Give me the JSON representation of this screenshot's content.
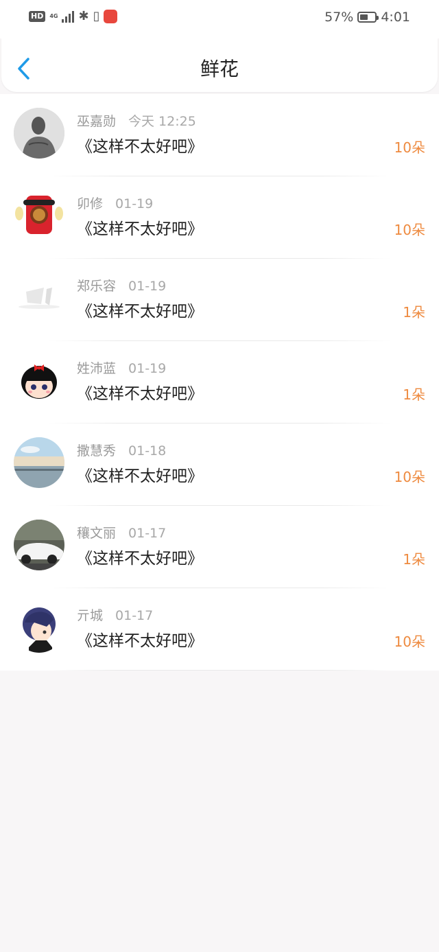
{
  "status_bar": {
    "hd": "HD",
    "network": "4G",
    "battery_percent": "57%",
    "battery_level": 0.57,
    "time": "4:01"
  },
  "header": {
    "title": "鲜花"
  },
  "list": [
    {
      "name": "巫嘉勋",
      "time": "今天 12:25",
      "message": "《这样不太好吧》",
      "count": "10朵"
    },
    {
      "name": "卯修",
      "time": "01-19",
      "message": "《这样不太好吧》",
      "count": "10朵"
    },
    {
      "name": "郑乐容",
      "time": "01-19",
      "message": "《这样不太好吧》",
      "count": "1朵"
    },
    {
      "name": "姓沛蓝",
      "time": "01-19",
      "message": "《这样不太好吧》",
      "count": "1朵"
    },
    {
      "name": "撒慧秀",
      "time": "01-18",
      "message": "《这样不太好吧》",
      "count": "10朵"
    },
    {
      "name": "穰文丽",
      "time": "01-17",
      "message": "《这样不太好吧》",
      "count": "1朵"
    },
    {
      "name": "亓城",
      "time": "01-17",
      "message": "《这样不太好吧》",
      "count": "10朵"
    }
  ],
  "colors": {
    "accent": "#1f9be8",
    "count": "#ee8a3f",
    "background": "#f8f6f7"
  }
}
